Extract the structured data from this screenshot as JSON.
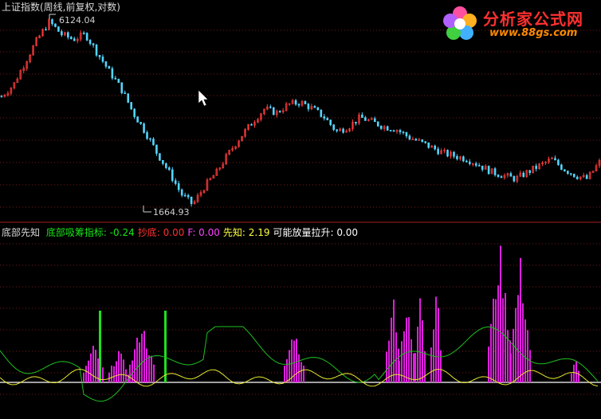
{
  "chart_panel": {
    "title": "上证指数(周线,前复权,对数)",
    "high_label": "6124.04",
    "low_label": "1664.93"
  },
  "indicator_panel": {
    "name": "底部先知",
    "items": [
      {
        "label": "底部吸筹指标:",
        "value": "-0.24",
        "color": "#19e619"
      },
      {
        "label": "抄底:",
        "value": "0.00",
        "color": "#ff3030"
      },
      {
        "label": "F:",
        "value": "0.00",
        "color": "#ff40ff"
      },
      {
        "label": "先知:",
        "value": "2.19",
        "color": "#ffff40"
      },
      {
        "label": "可能放量拉升:",
        "value": "0.00",
        "color": "#ffffff"
      }
    ]
  },
  "watermark": {
    "brand": "分析家公式网",
    "url": "www.88gs.com"
  },
  "colors": {
    "background": "#000000",
    "up_candle": "#ff3c3c",
    "down_candle": "#54d6ff",
    "grid": "#7a1a1a",
    "magenta_bar": "#e01ee0",
    "green_bar": "#1ee01e",
    "green_line": "#20c020",
    "yellow_line": "#e8e830",
    "baseline": "#ffffff"
  },
  "chart_data": {
    "type": "line",
    "price_extremes": {
      "high": 6124.04,
      "low": 1664.93
    },
    "price_path": [
      3600,
      3900,
      4600,
      5400,
      6124,
      5600,
      5400,
      5600,
      4900,
      4300,
      3800,
      3200,
      2800,
      2400,
      2100,
      1800,
      1665,
      1900,
      2100,
      2400,
      2700,
      3000,
      3300,
      3200,
      3400,
      3450,
      3300,
      3100,
      2800,
      2900,
      3100,
      3000,
      2900,
      2850,
      2700,
      2600,
      2500,
      2400,
      2350,
      2300,
      2200,
      2100,
      2050,
      2000,
      2100,
      2200,
      2300,
      2150,
      2050,
      2000,
      2250
    ]
  }
}
